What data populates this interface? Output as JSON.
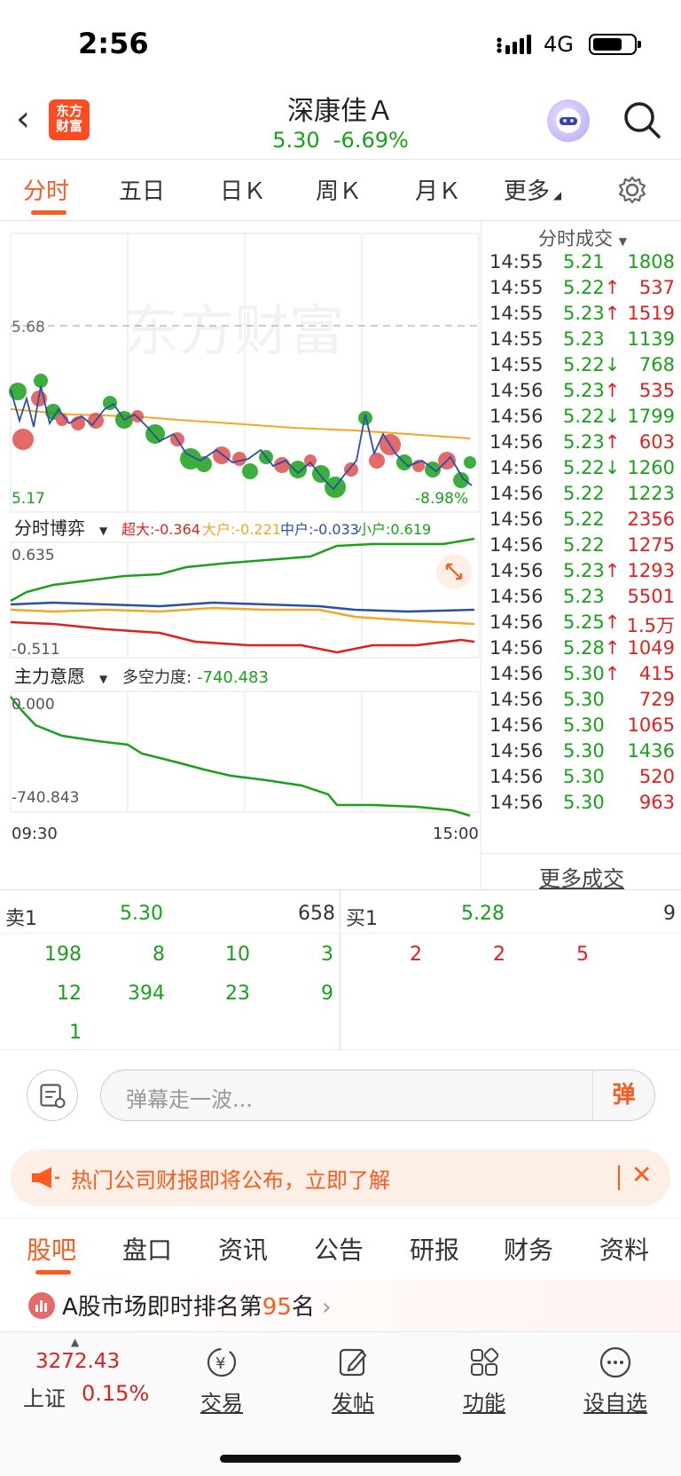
{
  "status": {
    "time": "2:56",
    "network": "4G"
  },
  "header": {
    "logo_text": "东方\n财富",
    "title": "深康佳Ａ",
    "price": "5.30",
    "change_pct": "-6.69%"
  },
  "tabs": [
    {
      "label": "分时"
    },
    {
      "label": "五日"
    },
    {
      "label": "日Ｋ"
    },
    {
      "label": "周Ｋ"
    },
    {
      "label": "月Ｋ"
    },
    {
      "label": "更多"
    }
  ],
  "chart": {
    "watermark": "东方财富",
    "price_high": "5.68",
    "price_low": "5.17",
    "pct_low": "-8.98%",
    "panel2": {
      "title": "分时博弈",
      "labels": [
        "超大:-0.364",
        "大户:-0.221",
        "中户:-0.033",
        "小户:0.619"
      ],
      "max": "0.635",
      "min": "-0.511"
    },
    "panel3": {
      "title": "主力意愿",
      "label": "多空力度:",
      "value": "-740.483",
      "max": "0.000",
      "min": "-740.843"
    },
    "time_start": "09:30",
    "time_end": "15:00",
    "colors": {
      "green": "#1aa01a",
      "red": "#e02020",
      "orange": "#f5a623",
      "blue": "#2a4fa8"
    }
  },
  "trades": {
    "title": "分时成交",
    "rows": [
      {
        "time": "14:55",
        "price": "5.21",
        "arrow": "",
        "pc": "g",
        "vol": "1808",
        "vc": "g"
      },
      {
        "time": "14:55",
        "price": "5.22",
        "arrow": "↑",
        "pc": "g",
        "vol": "537",
        "vc": "r"
      },
      {
        "time": "14:55",
        "price": "5.23",
        "arrow": "↑",
        "pc": "g",
        "vol": "1519",
        "vc": "r"
      },
      {
        "time": "14:55",
        "price": "5.23",
        "arrow": "",
        "pc": "g",
        "vol": "1139",
        "vc": "g"
      },
      {
        "time": "14:55",
        "price": "5.22",
        "arrow": "↓",
        "pc": "g",
        "vol": "768",
        "vc": "g"
      },
      {
        "time": "14:56",
        "price": "5.23",
        "arrow": "↑",
        "pc": "g",
        "vol": "535",
        "vc": "r"
      },
      {
        "time": "14:56",
        "price": "5.22",
        "arrow": "↓",
        "pc": "g",
        "vol": "1799",
        "vc": "g"
      },
      {
        "time": "14:56",
        "price": "5.23",
        "arrow": "↑",
        "pc": "g",
        "vol": "603",
        "vc": "r"
      },
      {
        "time": "14:56",
        "price": "5.22",
        "arrow": "↓",
        "pc": "g",
        "vol": "1260",
        "vc": "g"
      },
      {
        "time": "14:56",
        "price": "5.22",
        "arrow": "",
        "pc": "g",
        "vol": "1223",
        "vc": "g"
      },
      {
        "time": "14:56",
        "price": "5.22",
        "arrow": "",
        "pc": "g",
        "vol": "2356",
        "vc": "r"
      },
      {
        "time": "14:56",
        "price": "5.22",
        "arrow": "",
        "pc": "g",
        "vol": "1275",
        "vc": "r"
      },
      {
        "time": "14:56",
        "price": "5.23",
        "arrow": "↑",
        "pc": "g",
        "vol": "1293",
        "vc": "r"
      },
      {
        "time": "14:56",
        "price": "5.23",
        "arrow": "",
        "pc": "g",
        "vol": "5501",
        "vc": "r"
      },
      {
        "time": "14:56",
        "price": "5.25",
        "arrow": "↑",
        "pc": "g",
        "vol": "1.5万",
        "vc": "r"
      },
      {
        "time": "14:56",
        "price": "5.28",
        "arrow": "↑",
        "pc": "g",
        "vol": "1049",
        "vc": "r"
      },
      {
        "time": "14:56",
        "price": "5.30",
        "arrow": "↑",
        "pc": "g",
        "vol": "415",
        "vc": "r"
      },
      {
        "time": "14:56",
        "price": "5.30",
        "arrow": "",
        "pc": "g",
        "vol": "729",
        "vc": "r"
      },
      {
        "time": "14:56",
        "price": "5.30",
        "arrow": "",
        "pc": "g",
        "vol": "1065",
        "vc": "r"
      },
      {
        "time": "14:56",
        "price": "5.30",
        "arrow": "",
        "pc": "g",
        "vol": "1436",
        "vc": "g"
      },
      {
        "time": "14:56",
        "price": "5.30",
        "arrow": "",
        "pc": "g",
        "vol": "520",
        "vc": "r"
      },
      {
        "time": "14:56",
        "price": "5.30",
        "arrow": "",
        "pc": "g",
        "vol": "963",
        "vc": "r"
      }
    ],
    "more": "更多成交"
  },
  "orderbook": {
    "sell_label": "卖1",
    "sell_price": "5.30",
    "sell_vol": "658",
    "buy_label": "买1",
    "buy_price": "5.28",
    "buy_vol": "9",
    "sell_queue": [
      [
        "198",
        "8",
        "10",
        "3"
      ],
      [
        "12",
        "394",
        "23",
        "9"
      ],
      [
        "1"
      ]
    ],
    "buy_queue": [
      [
        "2",
        "2",
        "5"
      ]
    ]
  },
  "comment": {
    "placeholder": "弹幕走一波...",
    "danmu": "弹"
  },
  "notice": {
    "text": "热门公司财报即将公布，立即了解"
  },
  "bottom_tabs": [
    "股吧",
    "盘口",
    "资讯",
    "公告",
    "研报",
    "财务",
    "资料"
  ],
  "rank": {
    "prefix": "A股市场即时排名第",
    "number": "95",
    "suffix": "名"
  },
  "nav": {
    "index_value": "3272.43",
    "index_name": "上证",
    "index_pct": "0.15%",
    "items": [
      "交易",
      "发帖",
      "功能",
      "设自选"
    ]
  }
}
